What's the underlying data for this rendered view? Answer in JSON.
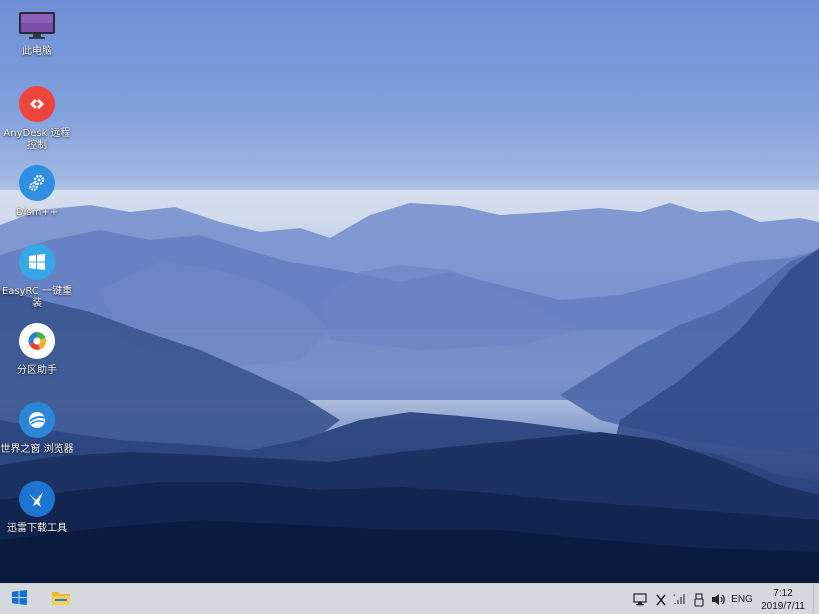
{
  "desktop": {
    "icons": [
      {
        "label": "此电脑",
        "icon": "monitor-icon",
        "color": "#7a4fa8"
      },
      {
        "label": "AnyDesk 远程控制",
        "icon": "anydesk-icon",
        "color": "#ef443b"
      },
      {
        "label": "Dism++",
        "icon": "gears-icon",
        "color": "#2f8fe0"
      },
      {
        "label": "EasyRC 一键重装",
        "icon": "windows-logo-icon",
        "color": "#35a8e8"
      },
      {
        "label": "分区助手",
        "icon": "pie-chart-icon",
        "color": "#ffffff"
      },
      {
        "label": "世界之窗 浏览器",
        "icon": "globe-icon",
        "color": "#2b86d8"
      },
      {
        "label": "迅雷下载工具",
        "icon": "bird-icon",
        "color": "#1f74d0"
      }
    ]
  },
  "taskbar": {
    "start_icon": "windows-start-icon",
    "pinned": [
      {
        "icon": "file-explorer-icon"
      }
    ],
    "tray": {
      "icons": [
        "network-icon",
        "close-x-icon",
        "wifi-icon",
        "usb-icon",
        "volume-icon"
      ],
      "language": "ENG"
    },
    "clock": {
      "time": "7:12",
      "date": "2019/7/11"
    }
  }
}
